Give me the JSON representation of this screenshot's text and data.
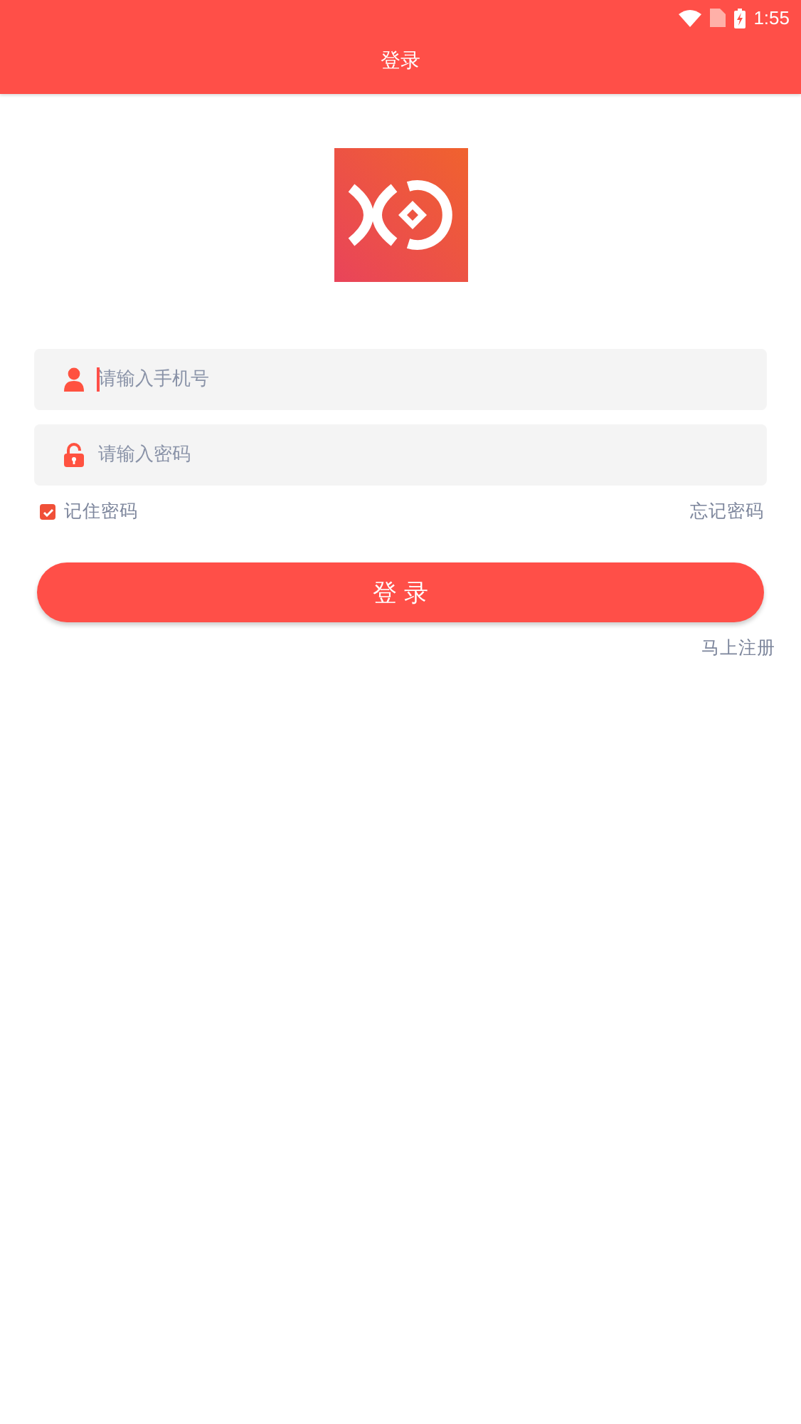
{
  "status_bar": {
    "time": "1:55"
  },
  "header": {
    "title": "登录"
  },
  "fields": [
    {
      "kind": "phone",
      "placeholder": "请输入手机号",
      "focused": true
    },
    {
      "kind": "password",
      "placeholder": "请输入密码",
      "focused": false
    }
  ],
  "remember": {
    "label": "记住密码",
    "checked": true
  },
  "forgot": {
    "label": "忘记密码"
  },
  "login_button": {
    "label": "登 录"
  },
  "register": {
    "label": "马上注册"
  }
}
